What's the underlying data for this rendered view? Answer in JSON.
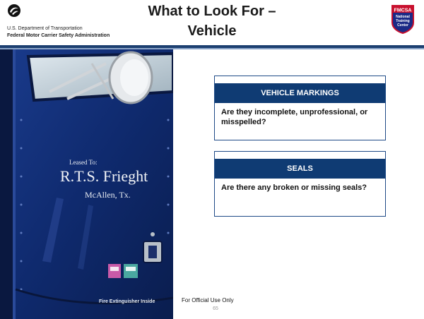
{
  "header": {
    "department": "U.S. Department of Transportation",
    "agency": "Federal Motor Carrier Safety Administration",
    "title_line1": "What to Look For –",
    "title_line2": "Vehicle",
    "badge": {
      "top": "FMCSA",
      "mid": "National",
      "line2": "Training",
      "line3": "Center"
    }
  },
  "photo": {
    "leased_to": "Leased To:",
    "company": "R.T.S. Frieght",
    "location": "McAllen, Tx.",
    "extinguisher": "Fire Extinguisher Inside"
  },
  "cards": [
    {
      "heading": "VEHICLE MARKINGS",
      "body": "Are they incomplete, unprofessional, or misspelled?"
    },
    {
      "heading": "SEALS",
      "body": "Are there any broken or missing seals?"
    }
  ],
  "footer": {
    "label": "For Official Use Only",
    "page": "65"
  },
  "colors": {
    "brand_navy": "#0f3b73",
    "rule": "#1c3f70",
    "truck_blue": "#0f2a6e"
  }
}
